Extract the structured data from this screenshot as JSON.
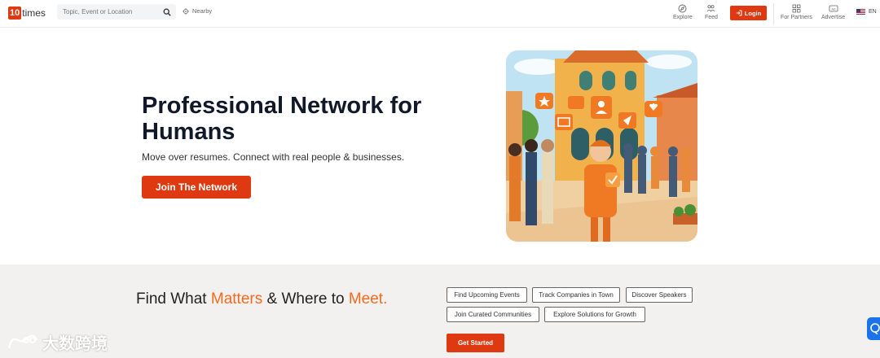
{
  "header": {
    "logo_number": "10",
    "logo_text": "times",
    "search_placeholder": "Topic, Event or Location",
    "nearby_label": "Nearby",
    "nav": {
      "explore": "Explore",
      "feed": "Feed",
      "login": "Login",
      "partners": "For Partners",
      "advertise": "Advertise",
      "language": "EN"
    }
  },
  "hero": {
    "title": "Professional Network for Humans",
    "subtitle": "Move over resumes. Connect with real people & businesses.",
    "cta_label": "Join The Network"
  },
  "discover": {
    "title_part1": "Find What ",
    "title_accent1": "Matters",
    "title_part2": " & Where to ",
    "title_accent2": "Meet.",
    "chips": [
      "Find Upcoming Events",
      "Track Companies in Town",
      "Discover Speakers",
      "Join Curated Communities",
      "Explore Solutions for Growth"
    ],
    "get_started_label": "Get Started"
  },
  "watermark_text": "大数跨境",
  "colors": {
    "brand": "#de3910",
    "accent_orange": "#f26b1d",
    "band_bg": "#f2f1ef"
  }
}
